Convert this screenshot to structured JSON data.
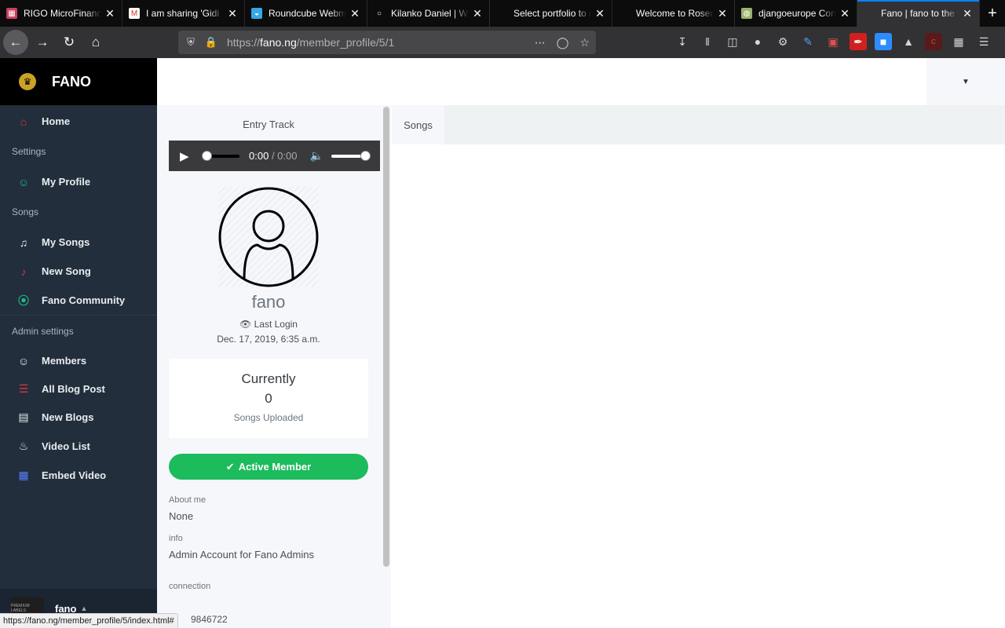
{
  "browser": {
    "tabs": [
      {
        "title": "RIGO MicroFinance",
        "icon": "▦",
        "icon_bg": "#c8405b"
      },
      {
        "title": "I am sharing 'Gidi",
        "icon": "M",
        "icon_bg": "#ffffff"
      },
      {
        "title": "Roundcube Webmail",
        "icon": "◒",
        "icon_bg": "#37a7e6"
      },
      {
        "title": "Kilanko Daniel | W",
        "icon": "○",
        "icon_bg": "#0c0c0d"
      },
      {
        "title": "Select portfolio to cha",
        "icon": "",
        "icon_bg": "#0c0c0d"
      },
      {
        "title": "Welcome to Rosenut S",
        "icon": "",
        "icon_bg": "#0c0c0d"
      },
      {
        "title": "djangoeurope Con",
        "icon": "◍",
        "icon_bg": "#9bb36e"
      },
      {
        "title": "Fano | fano to the worl",
        "icon": "",
        "icon_bg": "#323234"
      }
    ],
    "url_domain": "fano.ng",
    "url_prefix": "https://",
    "url_path": "/member_profile/5/1",
    "status_url": "https://fano.ng/member_profile/5/index.html#"
  },
  "sidebar": {
    "brand": "FANO",
    "home": "Home",
    "settings_header": "Settings",
    "my_profile": "My Profile",
    "songs_header": "Songs",
    "my_songs": "My Songs",
    "new_song": "New Song",
    "fano_community": "Fano Community",
    "admin_header": "Admin settings",
    "members": "Members",
    "all_blog_post": "All Blog Post",
    "new_blogs": "New Blogs",
    "video_list": "Video List",
    "embed_video": "Embed Video",
    "footer_user": "fano",
    "footer_avatar_text": "PREMIUM LABELS"
  },
  "profile": {
    "entry_track": "Entry Track",
    "player_time_current": "0:00",
    "player_time_total": "/ 0:00",
    "username": "fano",
    "last_login_label": "Last Login",
    "last_login_date": "Dec. 17, 2019, 6:35 a.m.",
    "currently_label": "Currently",
    "songs_count": "0",
    "songs_uploaded_label": "Songs Uploaded",
    "active_member": "Active Member",
    "about_me_label": "About me",
    "about_me_value": "None",
    "info_label": "info",
    "info_value": "Admin Account for Fano Admins",
    "connection_label": "connection",
    "connection_value_fragment": "9846722"
  },
  "songs": {
    "tab_label": "Songs"
  }
}
